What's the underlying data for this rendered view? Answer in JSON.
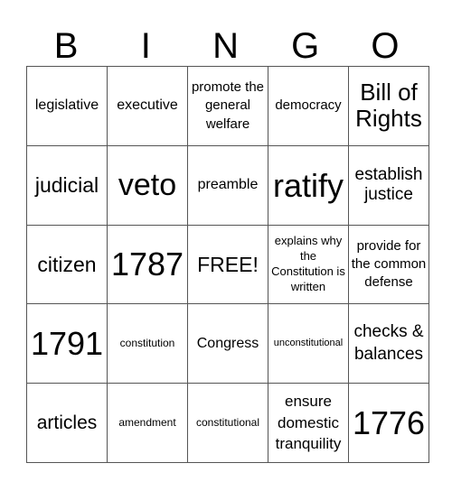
{
  "title_letters": [
    "B",
    "I",
    "N",
    "G",
    "O"
  ],
  "rows": [
    [
      "legislative",
      "executive",
      "promote the general welfare",
      "democracy",
      "Bill of Rights"
    ],
    [
      "judicial",
      "veto",
      "preamble",
      "ratify",
      "establish justice"
    ],
    [
      "citizen",
      "1787",
      "FREE!",
      "explains why the Constitution is written",
      "provide for the common defense"
    ],
    [
      "1791",
      "constitution",
      "Congress",
      "unconstitutional",
      "checks & balances"
    ],
    [
      "articles",
      "amendment",
      "constitutional",
      "ensure domestic tranquility",
      "1776"
    ]
  ],
  "free_space": "FREE!"
}
